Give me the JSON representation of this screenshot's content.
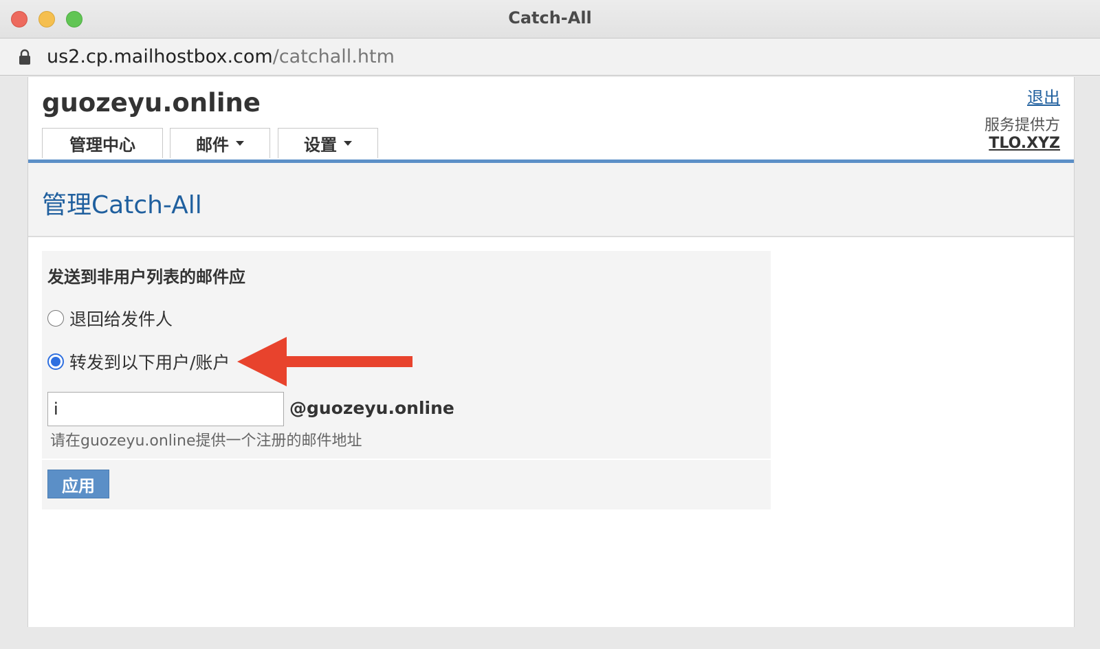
{
  "window": {
    "title": "Catch-All"
  },
  "address_bar": {
    "host": "us2.cp.mailhostbox.com",
    "path": "/catchall.htm"
  },
  "header": {
    "domain": "guozeyu.online",
    "logout_label": "退出",
    "provider_label": "服务提供方",
    "provider_name": "TLO.XYZ"
  },
  "nav": {
    "tabs": [
      {
        "label": "管理中心",
        "has_dropdown": false
      },
      {
        "label": "邮件",
        "has_dropdown": true
      },
      {
        "label": "设置",
        "has_dropdown": true
      }
    ]
  },
  "section": {
    "title": "管理Catch-All"
  },
  "form": {
    "question": "发送到非用户列表的邮件应",
    "options": [
      {
        "label": "退回给发件人",
        "checked": false
      },
      {
        "label": "转发到以下用户/账户",
        "checked": true
      }
    ],
    "forward_input_value": "i",
    "domain_suffix": "@guozeyu.online",
    "hint": "请在guozeyu.online提供一个注册的邮件地址",
    "apply_label": "应用"
  },
  "colors": {
    "accent": "#5b8fc7",
    "title_blue": "#1f5f9e",
    "annotation_arrow": "#e8432d",
    "radio_selected": "#2d6fe0"
  }
}
